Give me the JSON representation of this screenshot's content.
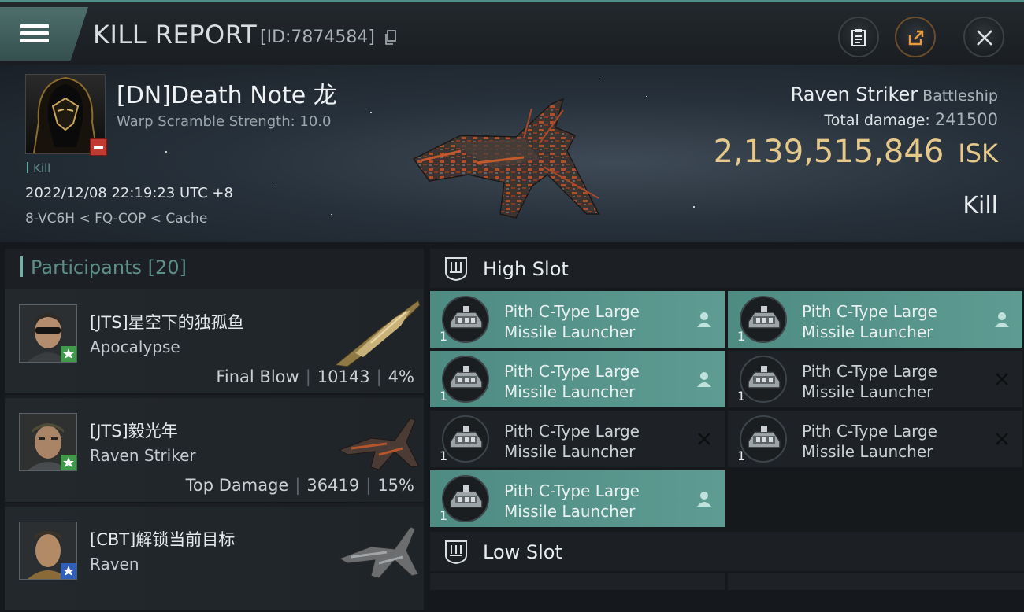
{
  "topbar": {
    "title": "KILL REPORT",
    "id_text": "[ID:7874584]"
  },
  "victim": {
    "name": "[DN]Death Note 龙",
    "warp_scramble": "Warp Scramble Strength: 10.0",
    "kill_tag": "Kill",
    "datetime": "2022/12/08 22:19:23 UTC +8",
    "location": "8-VC6H < FQ-COP < Cache",
    "ship_name": "Raven Striker",
    "ship_class": "Battleship",
    "total_damage_label": "Total damage:",
    "total_damage": "241500",
    "isk_value": "2,139,515,846",
    "isk_unit": "ISK",
    "result": "Kill"
  },
  "participants": {
    "title": "Participants [20]",
    "rows": [
      {
        "name": "[JTS]星空下的独孤鱼",
        "ship": "Apocalypse",
        "role": "Final Blow",
        "damage": "10143",
        "percent": "4%"
      },
      {
        "name": "[JTS]毅光年",
        "ship": "Raven Striker",
        "role": "Top Damage",
        "damage": "36419",
        "percent": "15%"
      },
      {
        "name": "[CBT]解锁当前目标",
        "ship": "Raven",
        "role": "",
        "damage": "",
        "percent": ""
      }
    ]
  },
  "high_slot": {
    "title": "High Slot",
    "modules": [
      {
        "name": "Pith C-Type Large\nMissile Launcher",
        "qty": "1",
        "status": "dropped"
      },
      {
        "name": "Pith C-Type Large\nMissile Launcher",
        "qty": "1",
        "status": "dropped"
      },
      {
        "name": "Pith C-Type Large\nMissile Launcher",
        "qty": "1",
        "status": "dropped"
      },
      {
        "name": "Pith C-Type Large\nMissile Launcher",
        "qty": "1",
        "status": "destroyed"
      },
      {
        "name": "Pith C-Type Large\nMissile Launcher",
        "qty": "1",
        "status": "destroyed"
      },
      {
        "name": "Pith C-Type Large\nMissile Launcher",
        "qty": "1",
        "status": "destroyed"
      },
      {
        "name": "Pith C-Type Large\nMissile Launcher",
        "qty": "1",
        "status": "dropped"
      }
    ]
  },
  "low_slot": {
    "title": "Low Slot"
  },
  "icons": {
    "menu": "hamburger-menu-icon",
    "copy": "copy-icon",
    "clipboard": "clipboard-icon",
    "share": "share-icon",
    "close": "close-icon",
    "dropped": "person-icon",
    "destroyed": "x-icon"
  },
  "colors": {
    "accent_teal": "#4e8b82",
    "isk_gold": "#e6c98a",
    "share_orange": "#d8892e"
  }
}
